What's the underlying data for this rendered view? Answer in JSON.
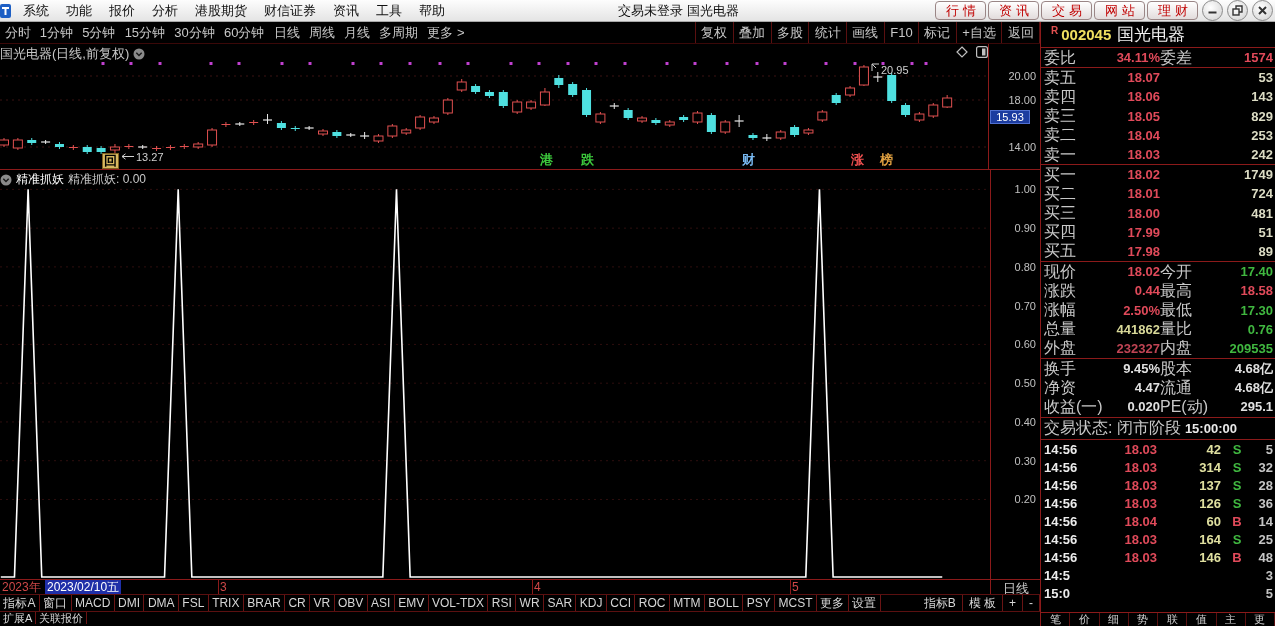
{
  "app_menu": [
    "系统",
    "功能",
    "报价",
    "分析",
    "港股期货",
    "财信证券",
    "资讯",
    "工具",
    "帮助"
  ],
  "window": {
    "title": "交易未登录 国光电器",
    "quick_buttons": [
      "行情",
      "资讯",
      "交易",
      "网站",
      "理财"
    ]
  },
  "period_bar": {
    "periods": [
      "分时",
      "1分钟",
      "5分钟",
      "15分钟",
      "30分钟",
      "60分钟",
      "日线",
      "周线",
      "月线",
      "多周期",
      "更多 >"
    ],
    "tools": [
      "复权",
      "叠加",
      "多股",
      "统计",
      "画线",
      "F10",
      "标记",
      "+自选",
      "返回"
    ]
  },
  "main_chart": {
    "title": "国光电器(日线,前复权)",
    "y_labels": [
      "20.00",
      "18.00",
      "14.00"
    ],
    "last_price": "15.93",
    "low_note": "13.27",
    "high_note": "20.95",
    "events": [
      {
        "text": "回",
        "kind": "boxed",
        "color": "#d8b860"
      },
      {
        "text": "港",
        "kind": "plain",
        "color": "#3cc83c"
      },
      {
        "text": "跌",
        "kind": "plain",
        "color": "#3cc83c"
      },
      {
        "text": "财",
        "kind": "plain",
        "color": "#78b8f0"
      },
      {
        "text": "涨",
        "kind": "plain",
        "color": "#f05050"
      },
      {
        "text": "榜",
        "kind": "plain",
        "color": "#e0a040"
      }
    ]
  },
  "indicator": {
    "reading": "精准抓妖: 0.00",
    "chart_data": {
      "type": "line",
      "grid": true,
      "categories": [
        null,
        null,
        null,
        null,
        null,
        null,
        null,
        null,
        null,
        null,
        null,
        null,
        null,
        null,
        null,
        null,
        null,
        null,
        null,
        null,
        null,
        null,
        null,
        null,
        null,
        null,
        null,
        null,
        null,
        null,
        null,
        null,
        null,
        null,
        null,
        null,
        null,
        null,
        null,
        null,
        null,
        null,
        null,
        null,
        null,
        null,
        null,
        null,
        null,
        null,
        null,
        null,
        null,
        null,
        null,
        null,
        null,
        null,
        null,
        null,
        null,
        null,
        null,
        null,
        null,
        null,
        null,
        null,
        null,
        null,
        null,
        null,
        null
      ],
      "ylim": [
        0,
        1.05
      ],
      "yticks": [
        {
          "value": 1,
          "label": "1.00"
        },
        {
          "value": 0.9,
          "label": "0.90"
        },
        {
          "value": 0.8,
          "label": "0.80"
        },
        {
          "value": 0.7,
          "label": "0.70"
        },
        {
          "value": 0.6,
          "label": "0.60"
        },
        {
          "value": 0.5,
          "label": "0.50"
        },
        {
          "value": 0.4,
          "label": "0.40"
        },
        {
          "value": 0.3,
          "label": "0.30"
        },
        {
          "value": 0.2,
          "label": "0.20"
        }
      ],
      "series": [
        {
          "name": "精准抓妖",
          "color": "#ffffff",
          "values": [
            0,
            0,
            1,
            0,
            0,
            0,
            0,
            0,
            0,
            0,
            0,
            0,
            0,
            1,
            0,
            0,
            0,
            0,
            0,
            0,
            0,
            0,
            0,
            0,
            0,
            0,
            0,
            0,
            0,
            1,
            0,
            0,
            0,
            0,
            0,
            0,
            0,
            0,
            0,
            0,
            0,
            0,
            0,
            0,
            0,
            0,
            0,
            0,
            0,
            0,
            0,
            0,
            0,
            0,
            0,
            0,
            0,
            0,
            0,
            0,
            1,
            0,
            0,
            0,
            0,
            0,
            0,
            0,
            0,
            0,
            null,
            null,
            null
          ]
        }
      ]
    }
  },
  "x_axis": {
    "year": "2023年",
    "cursor_date": "2023/02/10五",
    "months": [
      "3",
      "4",
      "5"
    ],
    "period": "日线"
  },
  "indicator_tabs": [
    "指标A",
    "窗口",
    "MACD",
    "DMI",
    "DMA",
    "FSL",
    "TRIX",
    "BRAR",
    "CR",
    "VR",
    "OBV",
    "ASI",
    "EMV",
    "VOL-TDX",
    "RSI",
    "WR",
    "SAR",
    "KDJ",
    "CCI",
    "ROC",
    "MTM",
    "BOLL",
    "PSY",
    "MCST",
    "更多",
    "设置"
  ],
  "indicator_tools": [
    "指标B",
    "模 板",
    "+",
    "-"
  ],
  "bottom_tabs": [
    "扩展A",
    "关联报价"
  ],
  "quote": {
    "market_flag": "R",
    "code": "002045",
    "name": "国光电器"
  },
  "order_summary": [
    {
      "label": "委比",
      "value": "34.11%"
    },
    {
      "label": "委差",
      "value": "1574"
    }
  ],
  "asks": [
    {
      "label": "卖五",
      "price": "18.07",
      "volume": "53"
    },
    {
      "label": "卖四",
      "price": "18.06",
      "volume": "143"
    },
    {
      "label": "卖三",
      "price": "18.05",
      "volume": "829"
    },
    {
      "label": "卖二",
      "price": "18.04",
      "volume": "253"
    },
    {
      "label": "卖一",
      "price": "18.03",
      "volume": "242"
    }
  ],
  "bids": [
    {
      "label": "买一",
      "price": "18.02",
      "volume": "1749"
    },
    {
      "label": "买二",
      "price": "18.01",
      "volume": "724"
    },
    {
      "label": "买三",
      "price": "18.00",
      "volume": "481"
    },
    {
      "label": "买四",
      "price": "17.99",
      "volume": "51"
    },
    {
      "label": "买五",
      "price": "17.98",
      "volume": "89"
    }
  ],
  "quote_stats": [
    {
      "label": "现价",
      "value": "18.02",
      "color": "#e04a5a"
    },
    {
      "label": "今开",
      "value": "17.40",
      "color": "#40b840"
    },
    {
      "label": "涨跌",
      "value": "0.44",
      "color": "#e04a5a"
    },
    {
      "label": "最高",
      "value": "18.58",
      "color": "#e04a5a"
    },
    {
      "label": "涨幅",
      "value": "2.50%",
      "color": "#e04a5a"
    },
    {
      "label": "最低",
      "value": "17.30",
      "color": "#40b840"
    },
    {
      "label": "总量",
      "value": "441862",
      "color": "#d8d898"
    },
    {
      "label": "量比",
      "value": "0.76",
      "color": "#40b840"
    },
    {
      "label": "外盘",
      "value": "232327",
      "color": "#c04454"
    },
    {
      "label": "内盘",
      "value": "209535",
      "color": "#40b840"
    }
  ],
  "fundamentals": [
    {
      "label": "换手",
      "value": "9.45%"
    },
    {
      "label": "股本",
      "value": "4.68亿"
    },
    {
      "label": "净资",
      "value": "4.47"
    },
    {
      "label": "流通",
      "value": "4.68亿"
    },
    {
      "label": "收益(一)",
      "value": "0.020"
    },
    {
      "label": "PE(动)",
      "value": "295.1"
    }
  ],
  "trade_status": {
    "label": "交易状态: 闭市阶段",
    "time": "15:00:00"
  },
  "ticks": [
    {
      "time": "14:56",
      "price": "18.03",
      "volume": "42",
      "side": "S",
      "kind": "sell",
      "count": "5"
    },
    {
      "time": "14:56",
      "price": "18.03",
      "volume": "314",
      "side": "S",
      "kind": "sell",
      "count": "32"
    },
    {
      "time": "14:56",
      "price": "18.03",
      "volume": "137",
      "side": "S",
      "kind": "sell",
      "count": "28"
    },
    {
      "time": "14:56",
      "price": "18.03",
      "volume": "126",
      "side": "S",
      "kind": "sell",
      "count": "36"
    },
    {
      "time": "14:56",
      "price": "18.04",
      "volume": "60",
      "side": "B",
      "kind": "buy",
      "count": "14"
    },
    {
      "time": "14:56",
      "price": "18.03",
      "volume": "164",
      "side": "S",
      "kind": "sell",
      "count": "25"
    },
    {
      "time": "14:56",
      "price": "18.03",
      "volume": "146",
      "side": "B",
      "kind": "buy",
      "count": "48"
    },
    {
      "time": "14:5",
      "count": "3"
    },
    {
      "time": "15:0",
      "count": "5"
    }
  ],
  "panel_tabs": [
    "笔",
    "价",
    "细",
    "势",
    "联",
    "值",
    "主",
    "更"
  ]
}
